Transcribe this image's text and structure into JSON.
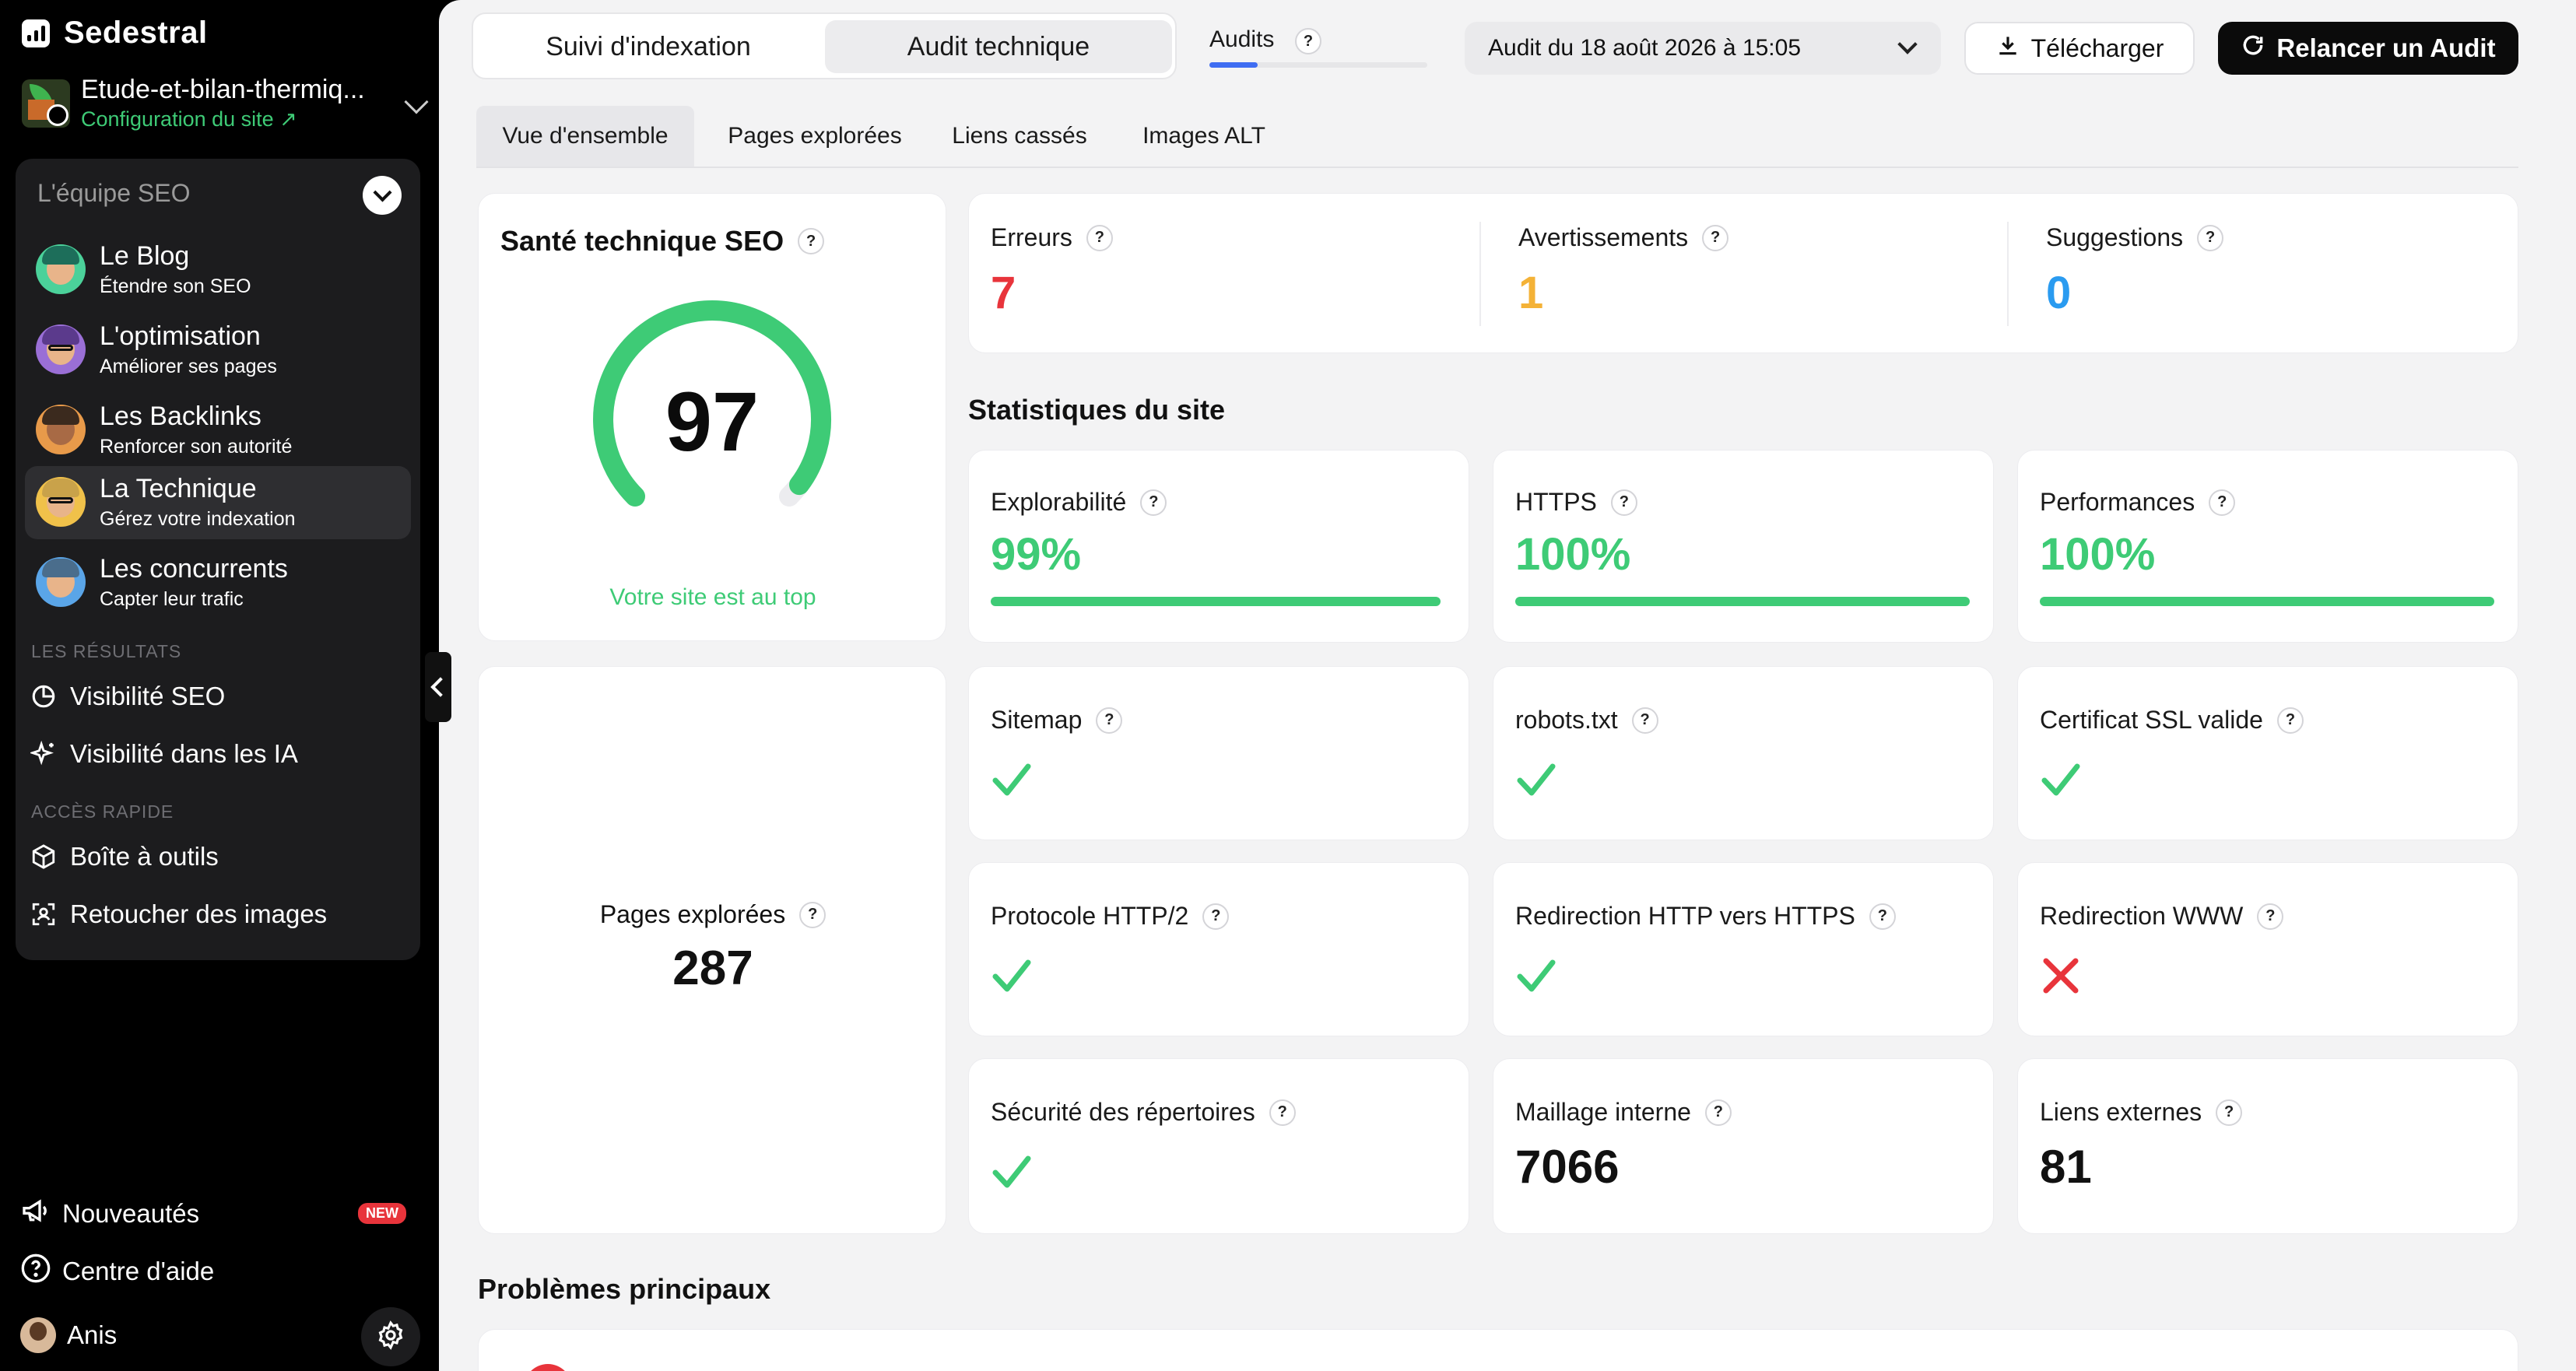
{
  "brand": {
    "name": "Sedestral"
  },
  "site": {
    "name": "Etude-et-bilan-thermiq...",
    "config_link": "Configuration du site ↗"
  },
  "team": {
    "header": "L'équipe SEO",
    "items": [
      {
        "title": "Le Blog",
        "subtitle": "Étendre son SEO",
        "hair": "#1d6e5a"
      },
      {
        "title": "L'optimisation",
        "subtitle": "Améliorer ses pages",
        "hair": "#5b3a8c"
      },
      {
        "title": "Les Backlinks",
        "subtitle": "Renforcer son autorité",
        "hair": "#3b2a1e"
      },
      {
        "title": "La Technique",
        "subtitle": "Gérez votre indexation",
        "hair": "#c9a24a"
      },
      {
        "title": "Les concurrents",
        "subtitle": "Capter leur trafic",
        "hair": "#4a6d8c"
      }
    ]
  },
  "results": {
    "label": "Les résultats",
    "items": [
      "Visibilité SEO",
      "Visibilité dans les IA"
    ]
  },
  "quick": {
    "label": "Accès rapide",
    "items": [
      "Boîte à outils",
      "Retoucher des images"
    ]
  },
  "bottom": {
    "news": "Nouveautés",
    "news_badge": "NEW",
    "help": "Centre d'aide",
    "user": "Anis"
  },
  "header": {
    "tabs": [
      "Suivi d'indexation",
      "Audit technique"
    ],
    "active_tab": 1,
    "audits_label": "Audits",
    "audits_progress": 0.22,
    "date_select": "Audit du 18 août 2026 à 15:05",
    "download": "Télécharger",
    "relaunch": "Relancer un Audit"
  },
  "subtabs": [
    "Vue d'ensemble",
    "Pages explorées",
    "Liens cassés",
    "Images ALT"
  ],
  "health": {
    "title": "Santé technique SEO",
    "score": "97",
    "score_fraction": 0.97,
    "status": "Votre site est au top"
  },
  "issues": [
    {
      "label": "Erreurs",
      "value": "7",
      "color": "#e8343b"
    },
    {
      "label": "Avertissements",
      "value": "1",
      "color": "#f4b237"
    },
    {
      "label": "Suggestions",
      "value": "0",
      "color": "#2a9bf0"
    }
  ],
  "stats_title": "Statistiques du site",
  "stats": [
    {
      "label": "Explorabilité",
      "value": "99%",
      "fraction": 0.99
    },
    {
      "label": "HTTPS",
      "value": "100%",
      "fraction": 1.0
    },
    {
      "label": "Performances",
      "value": "100%",
      "fraction": 1.0
    }
  ],
  "checks": [
    {
      "label": "Sitemap",
      "ok": true
    },
    {
      "label": "robots.txt",
      "ok": true
    },
    {
      "label": "Certificat SSL valide",
      "ok": true
    },
    {
      "label": "Protocole HTTP/2",
      "ok": true
    },
    {
      "label": "Redirection HTTP vers HTTPS",
      "ok": true
    },
    {
      "label": "Redirection WWW",
      "ok": false
    },
    {
      "label": "Sécurité des répertoires",
      "ok": true
    }
  ],
  "counts": [
    {
      "label": "Maillage interne",
      "value": "7066"
    },
    {
      "label": "Liens externes",
      "value": "81"
    }
  ],
  "pages": {
    "label": "Pages explorées",
    "value": "287"
  },
  "problems_title": "Problèmes principaux",
  "colors": {
    "green": "#3ecb76",
    "red": "#e8343b",
    "accent_blue": "#3f6df2"
  }
}
